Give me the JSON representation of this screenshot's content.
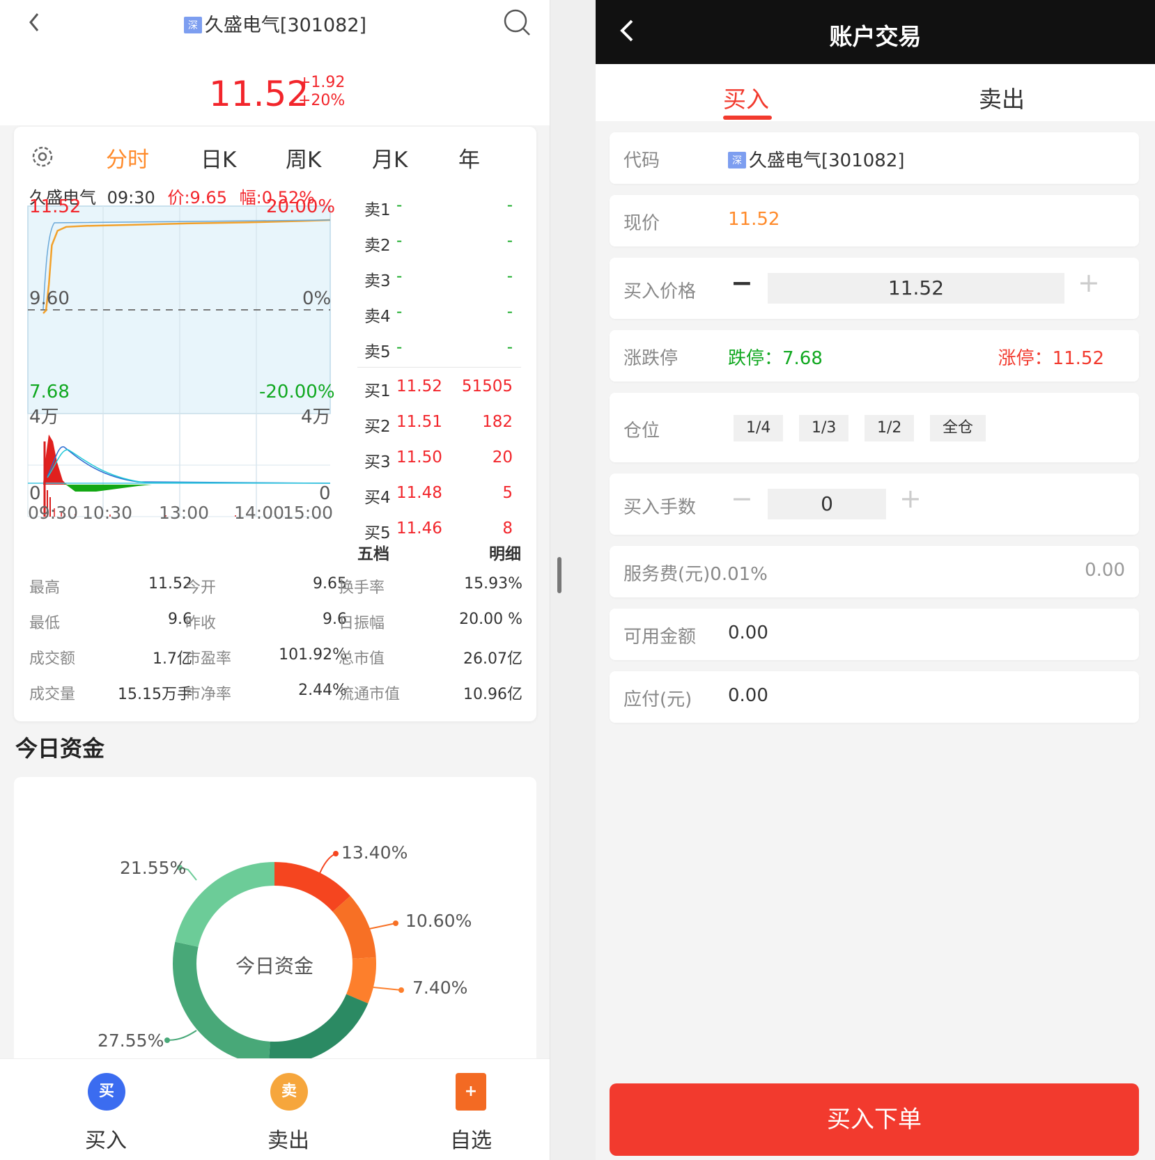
{
  "left": {
    "header": {
      "market_tag": "深",
      "stock_title": "久盛电气[301082]"
    },
    "price": {
      "current": "11.52",
      "change": "+1.92",
      "change_pct": "+20%"
    },
    "tabs": [
      "分时",
      "日K",
      "周K",
      "月K",
      "年"
    ],
    "quote_line": {
      "name": "久盛电气",
      "time": "09:30",
      "price": "价:9.65",
      "amp": "幅:0.52%"
    },
    "chart_data": {
      "type": "line",
      "price_axis": {
        "top": "11.52",
        "mid": "9.60",
        "bottom": "7.68"
      },
      "pct_axis": {
        "top": "20.00%",
        "mid": "0%",
        "bottom": "-20.00%"
      },
      "volume_axis": {
        "top_left": "4万",
        "top_right": "4万",
        "bottom_left": "0",
        "bottom_right": "0"
      },
      "x_ticks": [
        "09:30",
        "10:30",
        "13:00",
        "14:00",
        "15:00"
      ],
      "ylim": [
        7.68,
        11.52
      ],
      "price_series": {
        "t": [
          0,
          0.01,
          0.02,
          0.03,
          0.05,
          0.08,
          0.15,
          0.3,
          0.5,
          0.7,
          0.9,
          1.0
        ],
        "v": [
          9.6,
          9.66,
          10.2,
          11.0,
          11.3,
          11.38,
          11.4,
          11.42,
          11.45,
          11.47,
          11.5,
          11.52
        ]
      }
    },
    "orderbook": {
      "sell": [
        {
          "label": "卖1",
          "price": "-",
          "vol": "-"
        },
        {
          "label": "卖2",
          "price": "-",
          "vol": "-"
        },
        {
          "label": "卖3",
          "price": "-",
          "vol": "-"
        },
        {
          "label": "卖4",
          "price": "-",
          "vol": "-"
        },
        {
          "label": "卖5",
          "price": "-",
          "vol": "-"
        }
      ],
      "buy": [
        {
          "label": "买1",
          "price": "11.52",
          "vol": "51505"
        },
        {
          "label": "买2",
          "price": "11.51",
          "vol": "182"
        },
        {
          "label": "买3",
          "price": "11.50",
          "vol": "20"
        },
        {
          "label": "买4",
          "price": "11.48",
          "vol": "5"
        },
        {
          "label": "买5",
          "price": "11.46",
          "vol": "8"
        }
      ],
      "foot_left": "五档",
      "foot_right": "明细"
    },
    "stats": [
      [
        {
          "l": "最高",
          "v": "11.52"
        },
        {
          "l": "今开",
          "v": "9.65"
        },
        {
          "l": "换手率",
          "v": "15.93%"
        }
      ],
      [
        {
          "l": "最低",
          "v": "9.6"
        },
        {
          "l": "昨收",
          "v": "9.6"
        },
        {
          "l": "日振幅",
          "v": "20.00 %"
        }
      ],
      [
        {
          "l": "成交额",
          "v": "1.7亿"
        },
        {
          "l": "市盈率",
          "v": "101.92%"
        },
        {
          "l": "总市值",
          "v": "26.07亿"
        }
      ],
      [
        {
          "l": "成交量",
          "v": "15.15万手"
        },
        {
          "l": "市净率",
          "v": "2.44%"
        },
        {
          "l": "流通市值",
          "v": "10.96亿"
        }
      ]
    ],
    "section_title": "今日资金",
    "donut": {
      "center": "今日资金",
      "labels": [
        "13.40%",
        "10.60%",
        "7.40%",
        "21.55%",
        "27.55%"
      ],
      "slices": [
        {
          "pct": 13.4,
          "color": "#f5451f"
        },
        {
          "pct": 10.6,
          "color": "#f77025"
        },
        {
          "pct": 7.4,
          "color": "#fd7f2c"
        },
        {
          "pct": 19.5,
          "color": "#2b8a63"
        },
        {
          "pct": 27.55,
          "color": "#48a878"
        },
        {
          "pct": 21.55,
          "color": "#6ccc98"
        }
      ]
    },
    "bottom_bar": [
      {
        "icon": "买",
        "label": "买入",
        "color": "#3b6cf0"
      },
      {
        "icon": "卖",
        "label": "卖出",
        "color": "#f6a63c"
      },
      {
        "icon": "+",
        "label": "自选",
        "color": "#f36a23"
      }
    ]
  },
  "right": {
    "title": "账户交易",
    "tabs": [
      "买入",
      "卖出"
    ],
    "code_label": "代码",
    "code_tag": "深",
    "code_value": "久盛电气[301082]",
    "price_label": "现价",
    "price_value": "11.52",
    "buy_price_label": "买入价格",
    "buy_price_value": "11.52",
    "limit_label": "涨跌停",
    "limit_down": "跌停：7.68",
    "limit_up": "涨停：11.52",
    "pos_label": "仓位",
    "pos_opts": [
      "1/4",
      "1/3",
      "1/2",
      "全仓"
    ],
    "lots_label": "买入手数",
    "lots_value": "0",
    "fee_label": "服务费(元)0.01%",
    "fee_value": "0.00",
    "avail_label": "可用金额",
    "avail_value": "0.00",
    "pay_label": "应付(元)",
    "pay_value": "0.00",
    "buy_btn": "买入下单",
    "colors": {
      "accent": "#f23a2e",
      "orange": "#ff8a2a",
      "green": "#10a820"
    }
  }
}
